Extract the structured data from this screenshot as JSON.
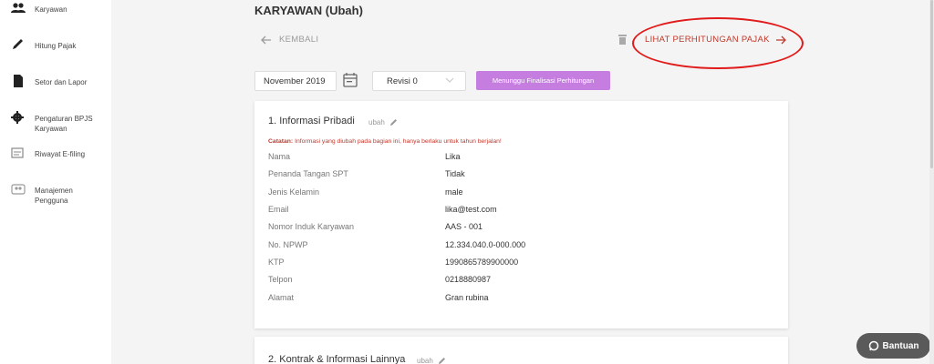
{
  "sidebar": {
    "items": [
      {
        "label": "Karyawan",
        "icon": "people-icon"
      },
      {
        "label": "Hitung Pajak",
        "icon": "pencil-icon"
      },
      {
        "label": "Setor dan Lapor",
        "icon": "document-icon"
      },
      {
        "label": "Pengaturan BPJS Karyawan",
        "icon": "gear-icon"
      },
      {
        "label": "Riwayat E-filing",
        "icon": "history-icon"
      },
      {
        "label": "Manajemen Pengguna",
        "icon": "users-manage-icon"
      }
    ]
  },
  "header": {
    "title": "KARYAWAN (Ubah)",
    "back_label": "KEMBALI",
    "action_label": "LIHAT PERHITUNGAN PAJAK"
  },
  "toolbar": {
    "period": "November 2019",
    "revision": "Revisi 0",
    "status_label": "Menunggu Finalisasi Perhitungan"
  },
  "section1": {
    "title": "1. Informasi Pribadi",
    "edit_label": "ubah",
    "note_prefix": "Catatan:",
    "note_text": " Informasi yang diubah pada bagian ini, hanya berlaku untuk tahun berjalan!",
    "rows": [
      {
        "key": "Nama",
        "value": "Lika"
      },
      {
        "key": "Penanda Tangan SPT",
        "value": "Tidak"
      },
      {
        "key": "Jenis Kelamin",
        "value": "male"
      },
      {
        "key": "Email",
        "value": "lika@test.com"
      },
      {
        "key": "Nomor Induk Karyawan",
        "value": "AAS - 001"
      },
      {
        "key": "No. NPWP",
        "value": "12.334.040.0-000.000"
      },
      {
        "key": "KTP",
        "value": "1990865789900000"
      },
      {
        "key": "Telpon",
        "value": "0218880987"
      },
      {
        "key": "Alamat",
        "value": "Gran rubina"
      }
    ]
  },
  "section2": {
    "title": "2. Kontrak & Informasi Lainnya",
    "edit_label": "ubah"
  },
  "help": {
    "label": "Bantuan"
  },
  "colors": {
    "accent": "#c0392b",
    "status": "#c57ee0",
    "highlight": "#e11b1b"
  }
}
